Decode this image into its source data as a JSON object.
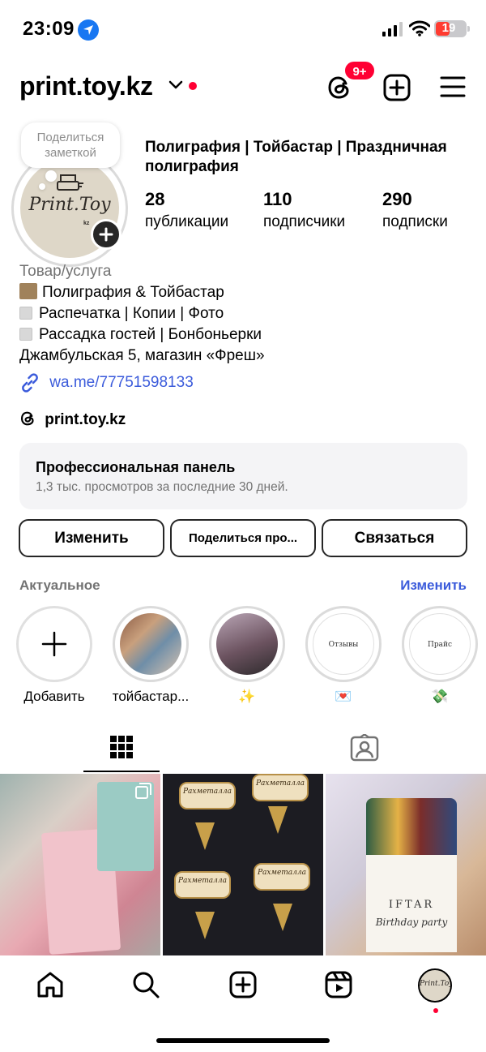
{
  "status_bar": {
    "time": "23:09",
    "battery": "19"
  },
  "header": {
    "username": "print.toy.kz",
    "notifications_badge": "9+"
  },
  "profile": {
    "note": "Поделиться заметкой",
    "avatar_logo": "Print.Toy",
    "avatar_sub": "kz",
    "category_title": "Полиграфия | Тойбастар | Праздничная полиграфия",
    "stats": [
      {
        "value": "28",
        "label": "публикации"
      },
      {
        "value": "110",
        "label": "подписчики"
      },
      {
        "value": "290",
        "label": "подписки"
      }
    ]
  },
  "bio": {
    "category": "Товар/услуга",
    "lines": [
      "Полиграфия & Тойбастар",
      "Распечатка | Копии | Фото",
      "Рассадка гостей | Бонбоньерки",
      "Джамбульская 5, магазин «Фреш»"
    ],
    "link": "wa.me/77751598133",
    "threads": "print.toy.kz"
  },
  "pro_panel": {
    "title": "Профессиональная панель",
    "subtitle": "1,3 тыс. просмотров за последние 30 дней."
  },
  "actions": {
    "edit": "Изменить",
    "share": "Поделиться про...",
    "contact": "Связаться"
  },
  "highlights": {
    "label": "Актуальное",
    "edit": "Изменить",
    "items": [
      {
        "caption": "Добавить"
      },
      {
        "caption": "тойбастар..."
      },
      {
        "caption": "✨"
      },
      {
        "caption": "💌",
        "inner_text": "Отзывы"
      },
      {
        "caption": "💸",
        "inner_text": "Прайс"
      }
    ]
  },
  "posts": {
    "label_text": "Рахметалла",
    "iftar_title": "IFTAR",
    "iftar_sub": "Birthday party"
  },
  "colors": {
    "link": "#3b5bdb",
    "badge": "#ff0033",
    "accent_dark": "#262626"
  },
  "icons": {
    "nav": [
      "home-icon",
      "search-icon",
      "create-icon",
      "reels-icon",
      "profile-icon"
    ]
  }
}
